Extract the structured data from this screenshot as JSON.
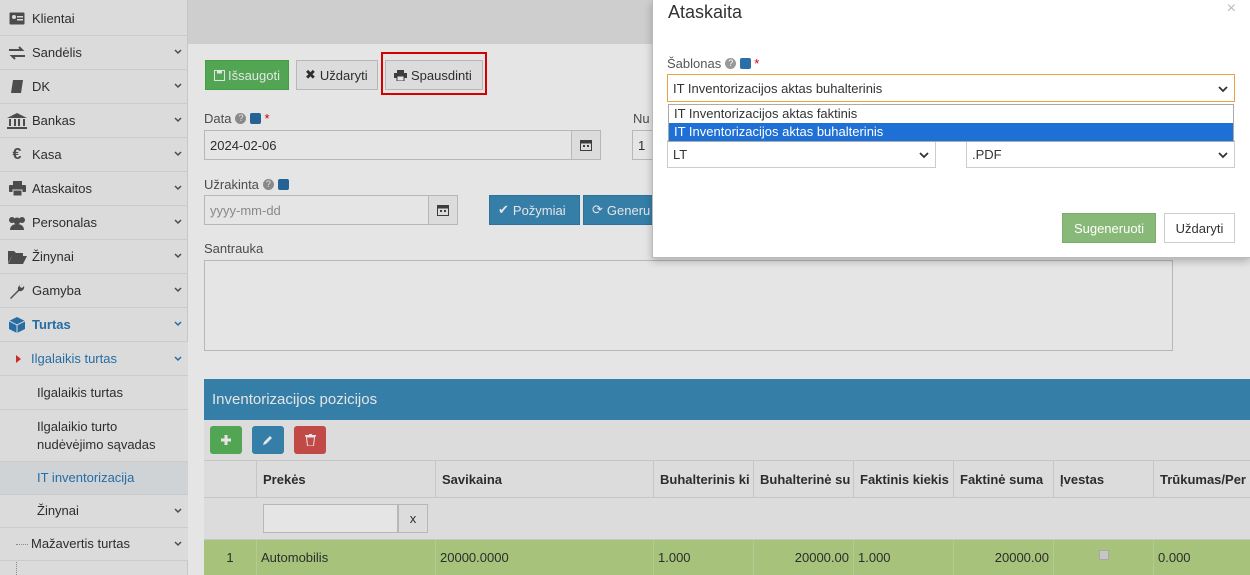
{
  "sidebar": {
    "items": [
      {
        "label": "Klientai"
      },
      {
        "label": "Sandėlis"
      },
      {
        "label": "DK"
      },
      {
        "label": "Bankas"
      },
      {
        "label": "Kasa"
      },
      {
        "label": "Ataskaitos"
      },
      {
        "label": "Personalas"
      },
      {
        "label": "Žinynai"
      },
      {
        "label": "Gamyba"
      },
      {
        "label": "Turtas"
      }
    ],
    "sub_group": "Ilgalaikis turtas",
    "sub_items": [
      "Ilgalaikis turtas",
      "Ilgalaikio turto nudėvėjimo sąvadas",
      "IT inventorizacija",
      "Žinynai"
    ],
    "next_group": "Mažavertis turtas"
  },
  "toolbar": {
    "save_label": "Išsaugoti",
    "close_label": "Uždaryti",
    "print_label": "Spausdinti"
  },
  "form": {
    "data_label": "Data",
    "data_value": "2024-02-06",
    "numeris_label": "Nu",
    "numeris_value": "1",
    "uzrakinta_label": "Užrakinta",
    "uzrakinta_placeholder": "yyyy-mm-dd",
    "pozymiai_label": "Požymiai",
    "generuoti_label": "Generu",
    "santrauka_label": "Santrauka"
  },
  "table": {
    "title": "Inventorizacijos pozicijos",
    "columns": [
      "Prekės",
      "Savikaina",
      "Buhalterinis ki",
      "Buhalterinė su",
      "Faktinis kiekis",
      "Faktinė suma",
      "Įvestas",
      "Trūkumas/Per"
    ],
    "clear_filter": "x",
    "rows": [
      {
        "nr": "1",
        "preke": "Automobilis",
        "savikaina": "20000.0000",
        "buh_kiekis": "1.000",
        "buh_suma": "20000.00",
        "fakt_kiekis": "1.000",
        "fakt_suma": "20000.00",
        "trukumas": "0.000"
      }
    ]
  },
  "modal": {
    "title": "Ataskaita",
    "close": "×",
    "sablonas_label": "Šablonas",
    "sablonas_value": "IT Inventorizacijos aktas buhalterinis",
    "options": [
      "IT Inventorizacijos aktas faktinis",
      "IT Inventorizacijos aktas buhalterinis"
    ],
    "language_value": "LT",
    "format_value": ".PDF",
    "generate_label": "Sugeneruoti",
    "close_label": "Uždaryti"
  },
  "colors": {
    "accent": "#3c8dbc",
    "success": "#5cb85c",
    "danger": "#d9534f",
    "row_highlight": "#b9d989",
    "dropdown_highlight": "#1e6fd6"
  }
}
